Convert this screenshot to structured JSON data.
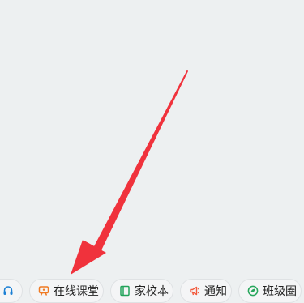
{
  "toolbar": {
    "chips": [
      {
        "label": "",
        "icon": "headset-icon",
        "icon_color": "#1a7fd4"
      },
      {
        "label": "在线课堂",
        "icon": "classroom-screen-icon",
        "icon_color": "#f07a22"
      },
      {
        "label": "家校本",
        "icon": "notebook-icon",
        "icon_color": "#22a35a"
      },
      {
        "label": "通知",
        "icon": "megaphone-icon",
        "icon_color": "#f25a3d"
      },
      {
        "label": "班级圈",
        "icon": "circle-leaf-icon",
        "icon_color": "#26a65b"
      }
    ]
  },
  "annotation": {
    "arrow_color": "#f0323c"
  }
}
